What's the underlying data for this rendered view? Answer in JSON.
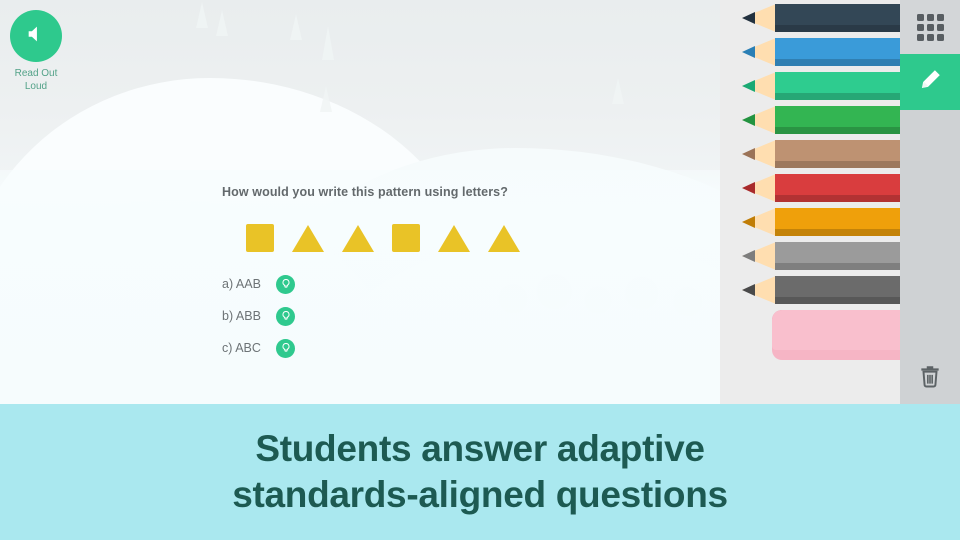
{
  "app": {
    "read_out_loud": {
      "label_line1": "Read Out",
      "label_line2": "Loud",
      "icon": "speaker-icon",
      "color": "#2ec98d"
    },
    "question": {
      "prompt": "How would you write this pattern using letters?",
      "pattern_shapes": [
        "square",
        "triangle",
        "triangle",
        "square",
        "triangle",
        "triangle"
      ],
      "shape_color": "#e9c327",
      "options": [
        {
          "label": "a) AAB",
          "hint_icon": "lightbulb-icon"
        },
        {
          "label": "b) ABB",
          "hint_icon": "lightbulb-icon"
        },
        {
          "label": "c) ABC",
          "hint_icon": "lightbulb-icon"
        }
      ]
    }
  },
  "tools": {
    "grid_button": {
      "icon": "grid-icon"
    },
    "pencil_button": {
      "icon": "pencil-icon",
      "color": "#2ec98d"
    },
    "trash_button": {
      "icon": "trash-icon"
    },
    "eraser": {
      "name": "eraser",
      "color": "#f9bfcd"
    },
    "pencils": [
      {
        "name": "navy",
        "color": "#334756"
      },
      {
        "name": "blue",
        "color": "#3a9bd9"
      },
      {
        "name": "teal",
        "color": "#2ecc8f"
      },
      {
        "name": "green",
        "color": "#33b552"
      },
      {
        "name": "tan",
        "color": "#be9272"
      },
      {
        "name": "red",
        "color": "#d93d3e"
      },
      {
        "name": "orange",
        "color": "#efa00b"
      },
      {
        "name": "light-gray",
        "color": "#9b9b9b"
      },
      {
        "name": "dark-gray",
        "color": "#6b6b6b"
      }
    ]
  },
  "caption": {
    "line1": "Students answer adaptive",
    "line2": "standards-aligned questions",
    "background": "#aae8ef",
    "text_color": "#1d5a52"
  }
}
